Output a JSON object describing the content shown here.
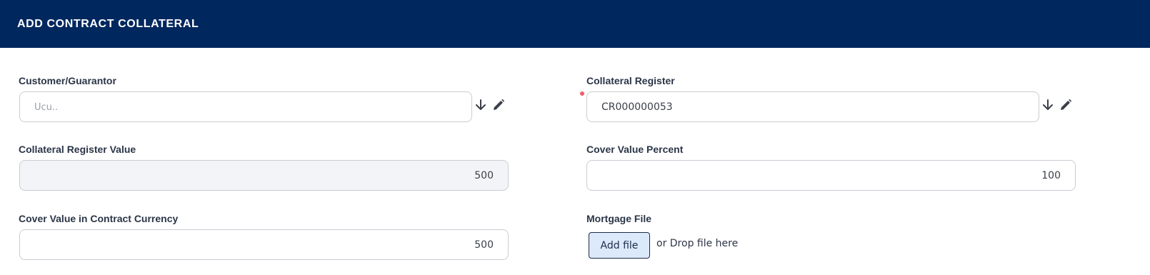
{
  "header": {
    "title": "ADD CONTRACT COLLATERAL"
  },
  "fields": {
    "customer_guarantor": {
      "label": "Customer/Guarantor",
      "value": "Ucu.."
    },
    "collateral_register": {
      "label": "Collateral Register",
      "value": "CR000000053",
      "required": true
    },
    "collateral_register_value": {
      "label": "Collateral Register Value",
      "value": "500"
    },
    "cover_value_percent": {
      "label": "Cover Value Percent",
      "value": "100"
    },
    "cover_value_contract_currency": {
      "label": "Cover Value in Contract Currency",
      "value": "500"
    },
    "mortgage_file": {
      "label": "Mortgage File",
      "add_button": "Add file",
      "drop_text": "or Drop file here"
    }
  },
  "icons": {
    "dropdown": "arrow-down-icon",
    "edit": "pencil-icon"
  },
  "colors": {
    "header_bg": "#00275e",
    "required_dot": "#f0606a",
    "add_file_bg": "#dce9fb",
    "readonly_bg": "#f3f4f8"
  }
}
